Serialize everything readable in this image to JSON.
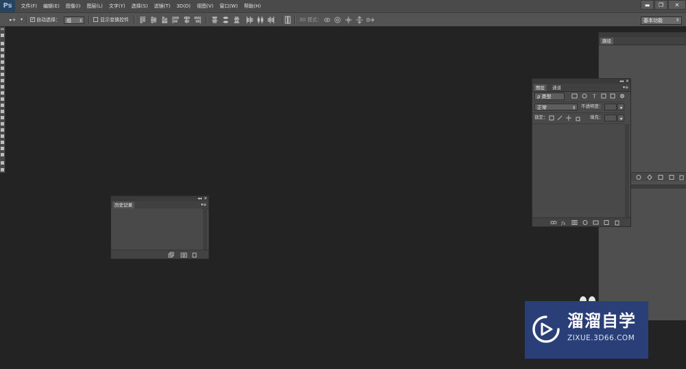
{
  "app": {
    "logo": "Ps"
  },
  "menu": [
    "文件(F)",
    "编辑(E)",
    "图像(I)",
    "图层(L)",
    "文字(Y)",
    "选择(S)",
    "滤镜(T)",
    "3D(D)",
    "视图(V)",
    "窗口(W)",
    "帮助(H)"
  ],
  "window_controls": {
    "minimize": "▬",
    "restore": "❐",
    "close": "✕"
  },
  "options_bar": {
    "move_tool_glyph": "▸+",
    "auto_select_label": "自动选择：",
    "auto_select_value": "组",
    "show_transform_label": "显示变换控件",
    "mode_3d_label": "3D 模式：",
    "workspace": "基本功能"
  },
  "dock": {
    "paths_tab": "路径"
  },
  "layers_panel": {
    "tabs": [
      "图层",
      "通道"
    ],
    "filter_kind": "ρ 类型",
    "blend_mode": "正常",
    "opacity_label": "不透明度：",
    "lock_label": "锁定：",
    "fill_label": "填充："
  },
  "history_panel": {
    "tab": "历史记录"
  },
  "watermark": {
    "title": "溜溜自学",
    "url": "ZIXUE.3D66.COM"
  },
  "colors": {
    "canvas": "#232323",
    "panel": "#494949",
    "menubar": "#4a4a4a",
    "logo_bg": "#27435f",
    "watermark_bg": "#2a3e77"
  }
}
